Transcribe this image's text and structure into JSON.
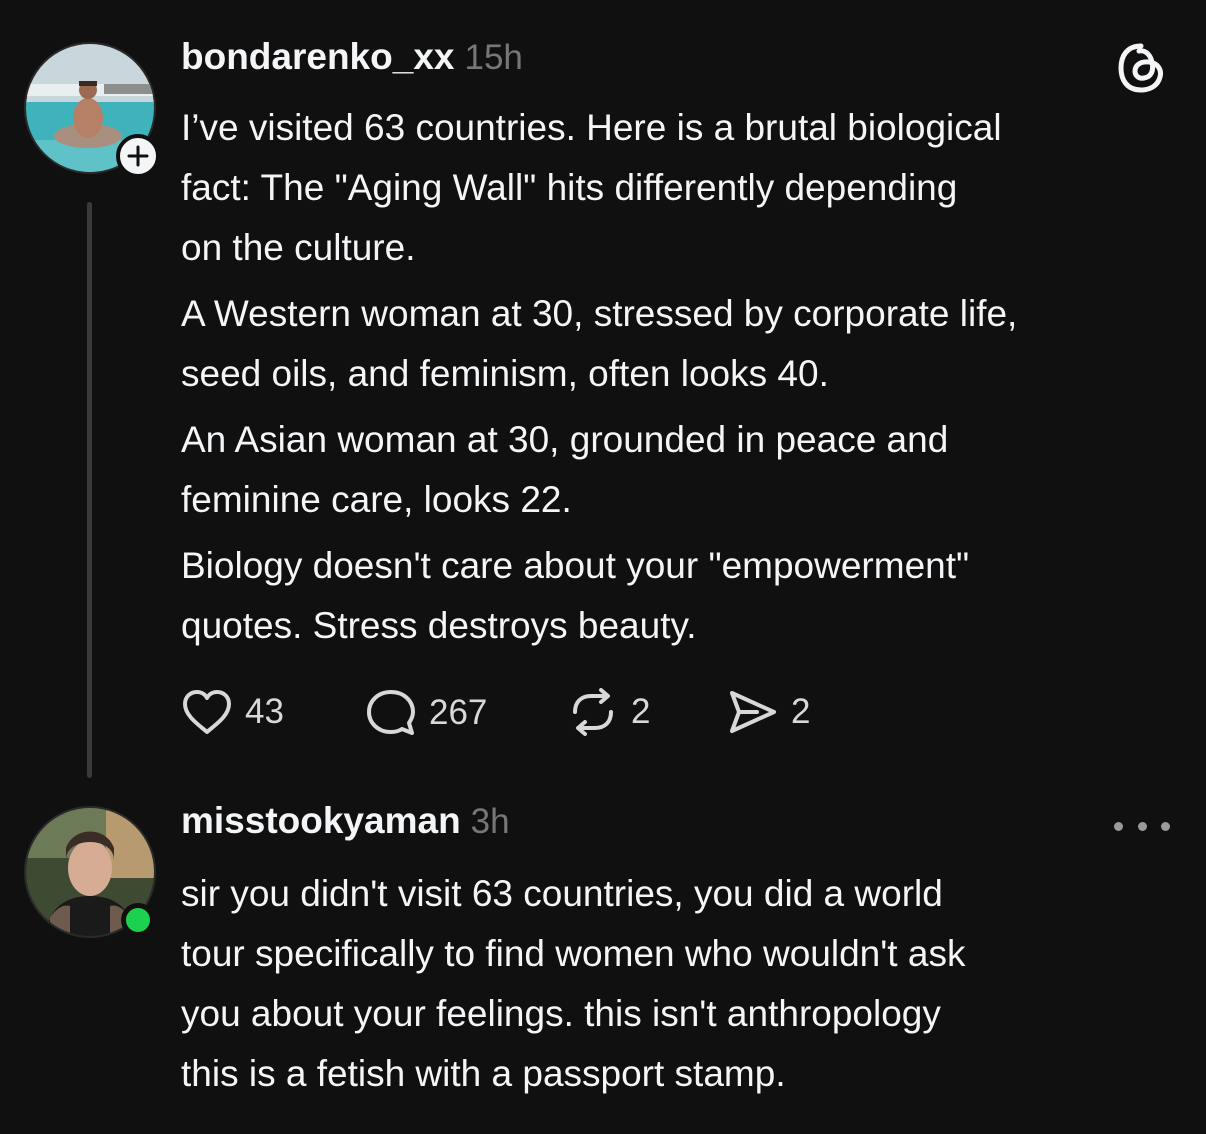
{
  "app": {
    "logo_icon": "threads-logo-icon",
    "accent_color": "#f3f5f7",
    "background_color": "#101010",
    "online_color": "#1cd14f"
  },
  "post": {
    "username": "bondarenko_xx",
    "time": "15h",
    "paragraphs": [
      "I’ve visited 63 countries. Here is a brutal biological\nfact: The \"Aging Wall\" hits differently depending\non the culture.",
      "A Western woman at 30, stressed by corporate life,\nseed oils, and feminism, often looks 40.",
      "An Asian woman at 30, grounded in peace and\nfeminine care, looks 22.",
      "Biology doesn't care about your \"empowerment\"\nquotes. Stress destroys beauty."
    ],
    "actions": {
      "likes": "43",
      "replies": "267",
      "reposts": "2",
      "shares": "2"
    },
    "follow_icon": "plus-icon"
  },
  "reply": {
    "username": "misstookyaman",
    "time": "3h",
    "paragraphs": [
      "sir you didn't visit 63 countries, you did a world\ntour specifically to find women who wouldn't ask\nyou about your feelings. this isn't anthropology\nthis is a fetish with a passport stamp."
    ],
    "more_icon": "more-dots-icon"
  }
}
